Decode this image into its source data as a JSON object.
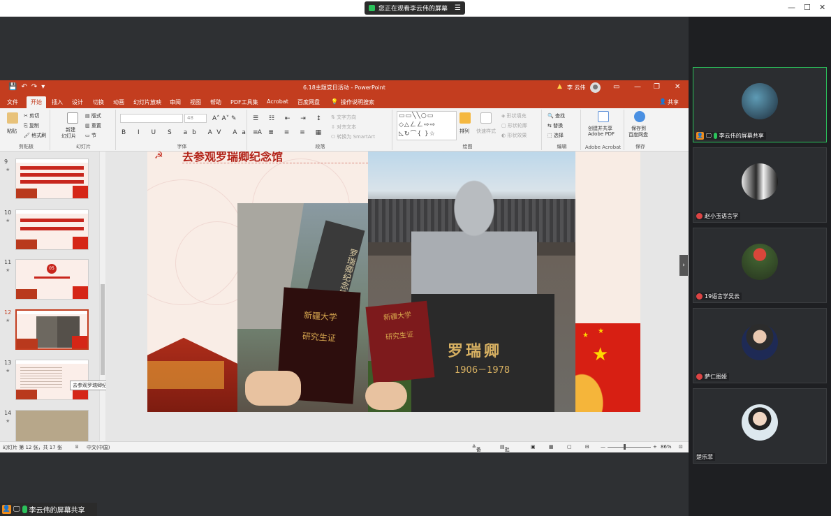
{
  "topbar": {
    "watching_label": "您正在观看李云伟的屏幕",
    "menu_icon": "menu-icon"
  },
  "ppt": {
    "document_title": "6.18主题党日活动 - PowerPoint",
    "user_name": "李 云伟",
    "share_label": "共享",
    "tabs": [
      "文件",
      "开始",
      "插入",
      "设计",
      "切换",
      "动画",
      "幻灯片放映",
      "审阅",
      "视图",
      "帮助",
      "PDF工具集",
      "Acrobat",
      "百度网盘"
    ],
    "tell_me": "操作说明搜索",
    "ribbon": {
      "paste": "粘贴",
      "cut": "剪切",
      "copy": "复制",
      "format_painter": "格式刷",
      "clipboard_group": "剪贴板",
      "new_slide": "新建",
      "new_slide_sub": "幻灯片",
      "layout": "版式",
      "reset": "重置",
      "section": "节",
      "slides_group": "幻灯片",
      "font_size": "48",
      "font_group": "字体",
      "text_direction": "文字方向",
      "align_text": "对齐文本",
      "convert_smartart": "转换为 SmartArt",
      "paragraph_group": "段落",
      "arrange": "排列",
      "quick_styles": "快速样式",
      "shape_fill": "形状填充",
      "shape_outline": "形状轮廓",
      "shape_effects": "形状效果",
      "drawing_group": "绘图",
      "find": "查找",
      "replace": "替换",
      "select": "选择",
      "editing_group": "编辑",
      "create_share_pdf": "创建并共享",
      "create_share_pdf2": "Adobe PDF",
      "adobe_group": "Adobe Acrobat",
      "save_baidu": "保存到",
      "save_baidu2": "百度网盘",
      "save_group": "保存"
    },
    "thumbnails": [
      {
        "num": "9",
        "star": "★"
      },
      {
        "num": "10",
        "star": "★"
      },
      {
        "num": "11",
        "star": "★",
        "badge": "05"
      },
      {
        "num": "12",
        "star": "★"
      },
      {
        "num": "13",
        "star": "★"
      },
      {
        "num": "14",
        "star": "★"
      }
    ],
    "tooltip": "去参观罗瑞卿纪念馆",
    "slide": {
      "title": "去参观罗瑞卿纪念馆",
      "sign_text": "罗瑞卿纪念馆",
      "book1_line1": "新疆大学",
      "book1_line2": "研究生证",
      "book2_line1": "新疆大学",
      "book2_line2": "研究生证",
      "statue_name": "罗瑞卿",
      "statue_years": "1906－1978"
    },
    "status": {
      "slide_info": "幻灯片 第 12 张，共 17 张",
      "language": "中文(中国)",
      "notes": "备注",
      "comments": "批注",
      "zoom": "86%"
    }
  },
  "share_bar": {
    "label": "李云伟的屏幕共享"
  },
  "participants": [
    {
      "name": "李云伟的屏幕共享",
      "active": true
    },
    {
      "name": "赵小玉语言学",
      "active": false
    },
    {
      "name": "19语言学吴云",
      "active": false
    },
    {
      "name": "萨仁图娅",
      "active": false
    },
    {
      "name": "楚乐菲",
      "active": false
    }
  ],
  "colors": {
    "ppt_accent": "#c33d1f",
    "mic_green": "#2bc25b",
    "share_orange": "#f08c1b"
  }
}
